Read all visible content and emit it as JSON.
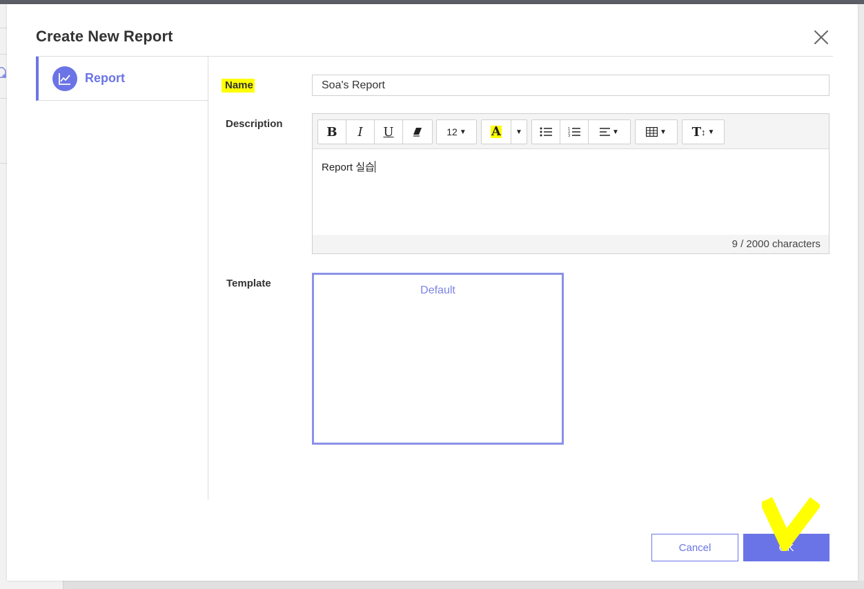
{
  "dialog": {
    "title": "Create New Report",
    "close_icon": "close-icon"
  },
  "nav": {
    "items": [
      {
        "label": "Report",
        "icon": "line-chart-icon",
        "active": true
      }
    ]
  },
  "form": {
    "name_label": "Name",
    "name_value": "Soa's Report",
    "description_label": "Description",
    "description_text": "Report 실습",
    "char_counter": "9 / 2000 characters",
    "template_label": "Template",
    "template_selected": "Default"
  },
  "toolbar": {
    "bold": "B",
    "italic": "I",
    "underline": "U",
    "font_size": "12",
    "font_color": "A",
    "heading": "T"
  },
  "footer": {
    "cancel_label": "Cancel",
    "ok_label": "OK"
  },
  "colors": {
    "accent": "#6b74e6",
    "highlight": "#ffff00",
    "template_border": "#8b91e8"
  }
}
